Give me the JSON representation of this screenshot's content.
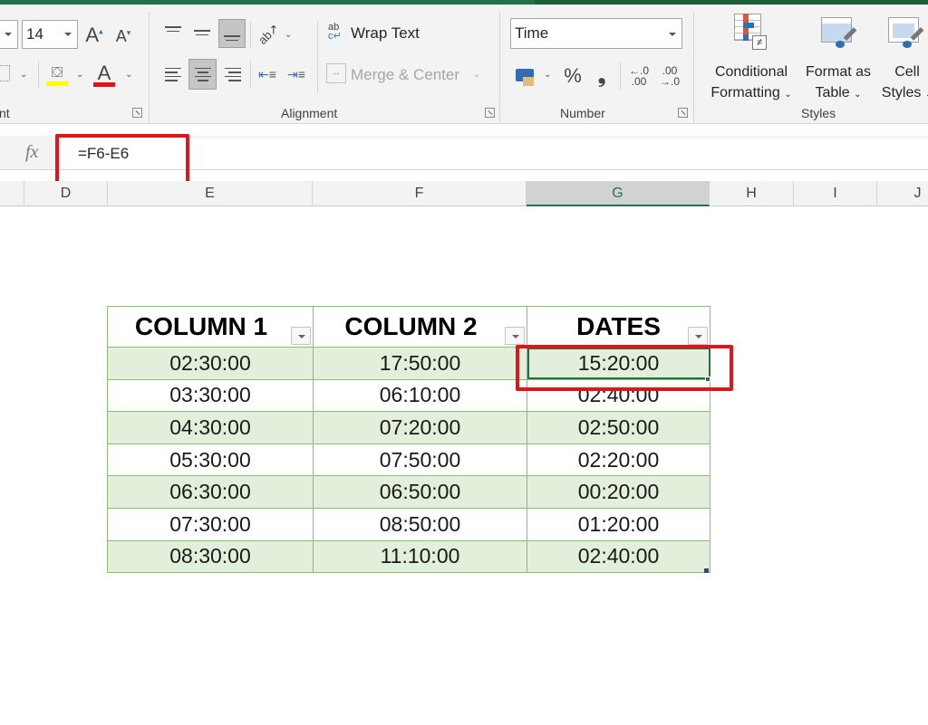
{
  "ribbon": {
    "font": {
      "size_value": "14",
      "grow_font_icon": "grow-font-icon",
      "shrink_font_icon": "shrink-font-icon",
      "fill_color": "#ffff00",
      "font_color": "#e0151b",
      "group_label_partial": "nt"
    },
    "alignment": {
      "wrap_text_label": "Wrap Text",
      "wrap_text_glyph_top": "ab",
      "wrap_text_glyph_bottom": "c↵",
      "merge_center_label": "Merge & Center",
      "group_label": "Alignment"
    },
    "number": {
      "format_value": "Time",
      "percent_label": "%",
      "comma_label": "❟",
      "increase_decimal_top": "←.0",
      "increase_decimal_bottom": ".00",
      "decrease_decimal_top": ".00",
      "decrease_decimal_bottom": "→.0",
      "group_label": "Number"
    },
    "styles": {
      "conditional_formatting_line1": "Conditional",
      "conditional_formatting_line2": "Formatting",
      "format_as_table_line1": "Format as",
      "format_as_table_line2": "Table",
      "cell_styles_line1": "Cell",
      "cell_styles_line2": "Styles",
      "group_label": "Styles"
    }
  },
  "formula_bar": {
    "fx_label": "fx",
    "formula": "=F6-E6"
  },
  "column_headers": [
    "D",
    "E",
    "F",
    "G",
    "H",
    "I",
    "J"
  ],
  "selected_column": "G",
  "table": {
    "headers": [
      "COLUMN 1",
      "COLUMN 2",
      "DATES"
    ],
    "rows": [
      [
        "02:30:00",
        "17:50:00",
        "15:20:00"
      ],
      [
        "03:30:00",
        "06:10:00",
        "02:40:00"
      ],
      [
        "04:30:00",
        "07:20:00",
        "02:50:00"
      ],
      [
        "05:30:00",
        "07:50:00",
        "02:20:00"
      ],
      [
        "06:30:00",
        "06:50:00",
        "00:20:00"
      ],
      [
        "07:30:00",
        "08:50:00",
        "01:20:00"
      ],
      [
        "08:30:00",
        "11:10:00",
        "02:40:00"
      ]
    ],
    "band_color": "#e2efda",
    "border_color": "#8fbc74"
  },
  "highlight_color": "#e0151b",
  "accent_color": "#217346"
}
